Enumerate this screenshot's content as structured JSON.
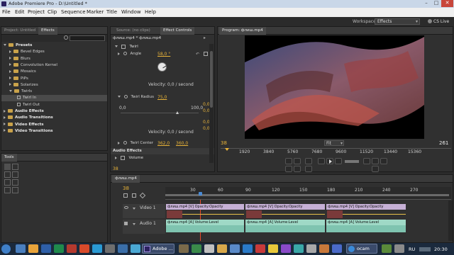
{
  "window": {
    "title": "Adobe Premiere Pro - D:\\Untitled *",
    "controls": [
      "–",
      "□",
      "✕"
    ]
  },
  "menu": [
    "File",
    "Edit",
    "Project",
    "Clip",
    "Sequence",
    "Marker",
    "Title",
    "Window",
    "Help"
  ],
  "workspace": {
    "label": "Workspace:",
    "value": "Effects",
    "cslive": "CS Live"
  },
  "project": {
    "tab_project": "Project: Untitled",
    "tab_effects": "Effects",
    "items": [
      {
        "label": "Presets",
        "level": 0,
        "bold": true
      },
      {
        "label": "Bevel Edges",
        "level": 1
      },
      {
        "label": "Blurs",
        "level": 1
      },
      {
        "label": "Convolution Kernel",
        "level": 1
      },
      {
        "label": "Mosaics",
        "level": 1
      },
      {
        "label": "PiPs",
        "level": 1
      },
      {
        "label": "Solarizes",
        "level": 1
      },
      {
        "label": "Twirls",
        "level": 1
      },
      {
        "label": "Twirl In",
        "level": 2
      },
      {
        "label": "Twirl Out",
        "level": 2
      },
      {
        "label": "Audio Effects",
        "level": 0,
        "bold": true
      },
      {
        "label": "Audio Transitions",
        "level": 0,
        "bold": true
      },
      {
        "label": "Video Effects",
        "level": 0,
        "bold": true
      },
      {
        "label": "Video Transitions",
        "level": 0,
        "bold": true
      }
    ]
  },
  "tools": {
    "title": "Tools"
  },
  "effect_controls": {
    "tab_source": "Source: (no clips)",
    "tab_ec": "Effect Controls",
    "clip_label": "флиш.mp4 * флиш.mp4",
    "twirl": "Twirl",
    "angle_label": "Angle",
    "angle_value": "58,0 °",
    "velocity1": "Velocity: 0,0 / second",
    "radius_label": "Twirl Radius",
    "radius_value": "75,0",
    "slider_min": "0,0",
    "slider_max": "100,0",
    "side_vals": [
      "0,0",
      "0,0",
      "0,0",
      "0,0"
    ],
    "velocity2": "Velocity: 0,0 / second",
    "center_label": "Twirl Center",
    "center_x": "362,0",
    "center_y": "360,0",
    "audio_effects": "Audio Effects",
    "volume": "Volume",
    "timecode": "38"
  },
  "program": {
    "title": "Program: флиш.mp4",
    "timecode": "38",
    "fit": "Fit",
    "end": "261",
    "ruler": [
      "1920",
      "3840",
      "5760",
      "7680",
      "9600",
      "11520",
      "13440",
      "15360"
    ]
  },
  "timeline": {
    "tab": "флиш.mp4",
    "timecode": "38",
    "ruler": [
      "30",
      "60",
      "90",
      "120",
      "150",
      "180",
      "210",
      "240",
      "270"
    ],
    "video_track": "Video 1",
    "audio_track": "Audio 1",
    "video_clip": "флиш.mp4 [V]",
    "video_fx": "Opacity:Opacity",
    "audio_clip": "флиш.mp4 [A]",
    "audio_fx": "Volume:Level"
  },
  "taskbar": {
    "app_label": "Adobe ...",
    "ocam": "ocam",
    "lang": "RU",
    "time": "20:30"
  },
  "colors": {
    "accent": "#e8b339",
    "video_clip": "#c6b0d6",
    "audio_clip": "#9fd9c6",
    "playhead": "#e84a2a"
  }
}
